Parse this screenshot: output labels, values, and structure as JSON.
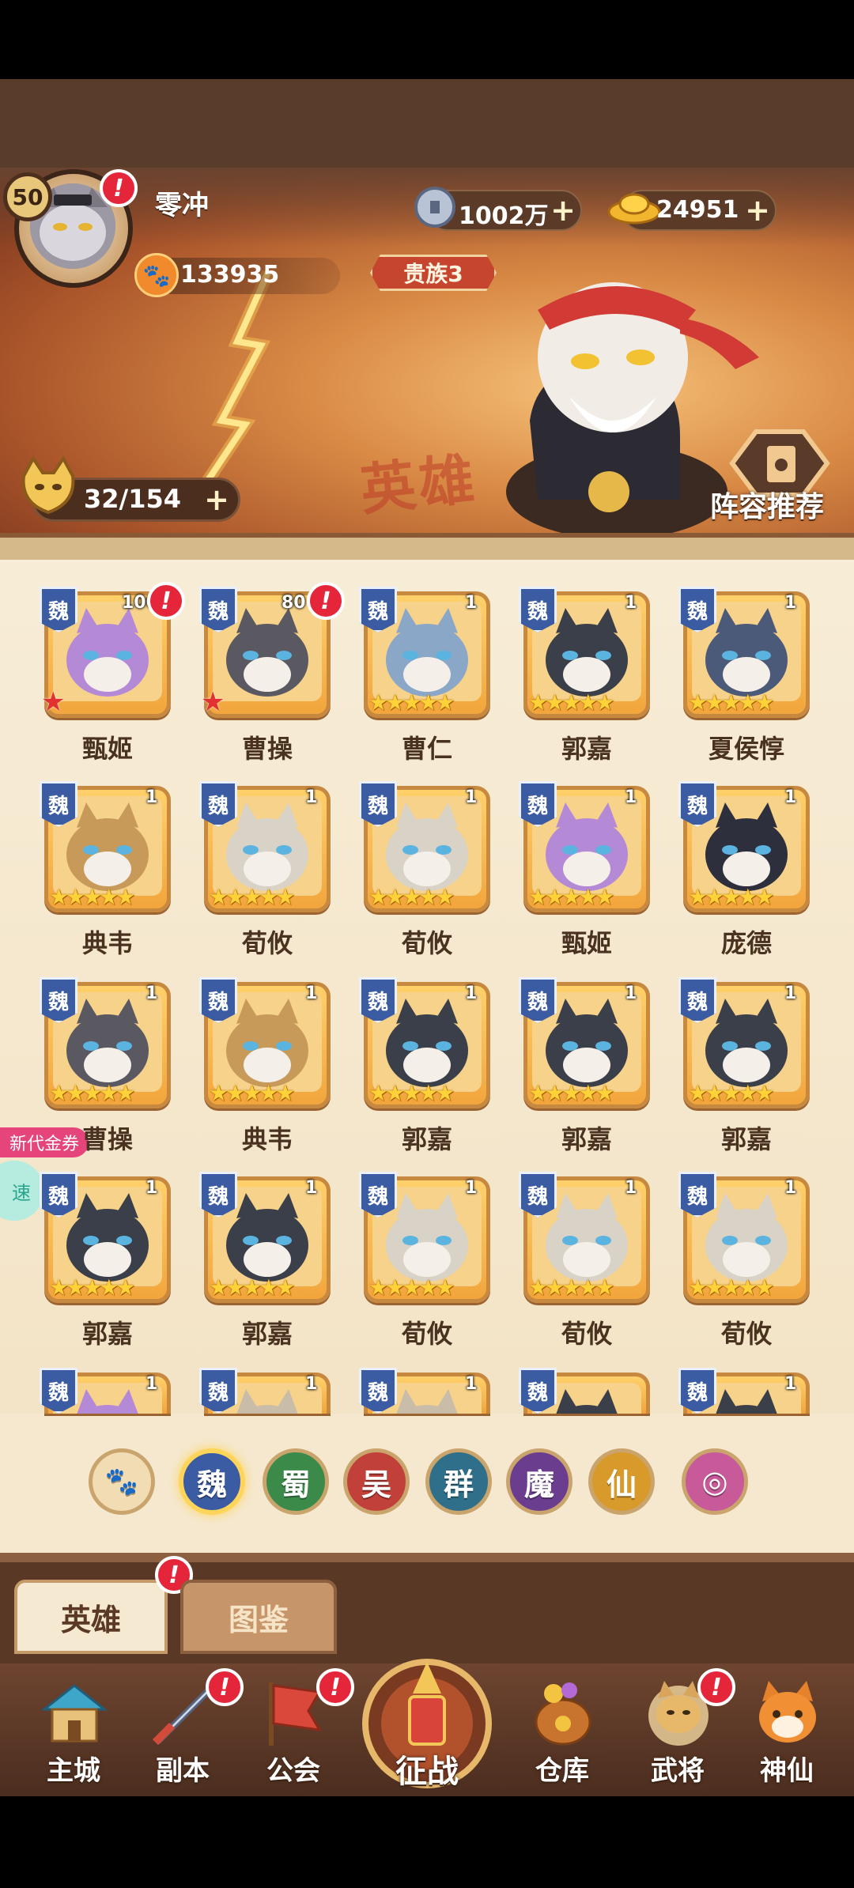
{
  "player": {
    "level": "50",
    "name": "零冲",
    "power": "133935",
    "rank": "贵族3"
  },
  "resources": {
    "coins": "1002万",
    "gold": "24951"
  },
  "hero_count": "32/154",
  "lineup_label": "阵容推荐",
  "banner_watermark": "英雄",
  "heroes": [
    {
      "name": "甄姬",
      "faction": "魏",
      "level": "100",
      "stars": "",
      "red_star": true,
      "alert": true,
      "color": "#b48ad6"
    },
    {
      "name": "曹操",
      "faction": "魏",
      "level": "80",
      "stars": "",
      "red_star": true,
      "alert": true,
      "color": "#5a5860"
    },
    {
      "name": "曹仁",
      "faction": "魏",
      "level": "1",
      "stars": "★★★★★",
      "red_star": false,
      "alert": false,
      "color": "#8aa7c7"
    },
    {
      "name": "郭嘉",
      "faction": "魏",
      "level": "1",
      "stars": "★★★★★",
      "red_star": false,
      "alert": false,
      "color": "#3a3f4a"
    },
    {
      "name": "夏侯惇",
      "faction": "魏",
      "level": "1",
      "stars": "★★★★★",
      "red_star": false,
      "alert": false,
      "color": "#4b5a78"
    },
    {
      "name": "典韦",
      "faction": "魏",
      "level": "1",
      "stars": "★★★★★",
      "red_star": false,
      "alert": false,
      "color": "#c89a5a"
    },
    {
      "name": "荀攸",
      "faction": "魏",
      "level": "1",
      "stars": "★★★★★",
      "red_star": false,
      "alert": false,
      "color": "#d9d2c6"
    },
    {
      "name": "荀攸",
      "faction": "魏",
      "level": "1",
      "stars": "★★★★★",
      "red_star": false,
      "alert": false,
      "color": "#d9d2c6"
    },
    {
      "name": "甄姬",
      "faction": "魏",
      "level": "1",
      "stars": "★★★★★",
      "red_star": false,
      "alert": false,
      "color": "#b48ad6"
    },
    {
      "name": "庞德",
      "faction": "魏",
      "level": "1",
      "stars": "★★★★★",
      "red_star": false,
      "alert": false,
      "color": "#2e2f3d"
    },
    {
      "name": "曹操",
      "faction": "魏",
      "level": "1",
      "stars": "★★★★★",
      "red_star": false,
      "alert": false,
      "color": "#5a5860"
    },
    {
      "name": "典韦",
      "faction": "魏",
      "level": "1",
      "stars": "★★★★★",
      "red_star": false,
      "alert": false,
      "color": "#c89a5a"
    },
    {
      "name": "郭嘉",
      "faction": "魏",
      "level": "1",
      "stars": "★★★★★",
      "red_star": false,
      "alert": false,
      "color": "#3a3f4a"
    },
    {
      "name": "郭嘉",
      "faction": "魏",
      "level": "1",
      "stars": "★★★★★",
      "red_star": false,
      "alert": false,
      "color": "#3a3f4a"
    },
    {
      "name": "郭嘉",
      "faction": "魏",
      "level": "1",
      "stars": "★★★★★",
      "red_star": false,
      "alert": false,
      "color": "#3a3f4a"
    },
    {
      "name": "郭嘉",
      "faction": "魏",
      "level": "1",
      "stars": "★★★★★",
      "red_star": false,
      "alert": false,
      "color": "#3a3f4a"
    },
    {
      "name": "郭嘉",
      "faction": "魏",
      "level": "1",
      "stars": "★★★★★",
      "red_star": false,
      "alert": false,
      "color": "#3a3f4a"
    },
    {
      "name": "荀攸",
      "faction": "魏",
      "level": "1",
      "stars": "★★★★★",
      "red_star": false,
      "alert": false,
      "color": "#d9d2c6"
    },
    {
      "name": "荀攸",
      "faction": "魏",
      "level": "1",
      "stars": "★★★★★",
      "red_star": false,
      "alert": false,
      "color": "#d9d2c6"
    },
    {
      "name": "荀攸",
      "faction": "魏",
      "level": "1",
      "stars": "★★★★★",
      "red_star": false,
      "alert": false,
      "color": "#d9d2c6"
    },
    {
      "name": "",
      "faction": "魏",
      "level": "1",
      "stars": "",
      "red_star": false,
      "alert": false,
      "color": "#b48ad6"
    },
    {
      "name": "",
      "faction": "魏",
      "level": "1",
      "stars": "",
      "red_star": false,
      "alert": false,
      "color": "#c9bca8"
    },
    {
      "name": "",
      "faction": "魏",
      "level": "1",
      "stars": "",
      "red_star": false,
      "alert": false,
      "color": "#c9bca8"
    },
    {
      "name": "",
      "faction": "魏",
      "level": "",
      "stars": "",
      "red_star": false,
      "alert": false,
      "color": "#3a3f4a"
    },
    {
      "name": "",
      "faction": "魏",
      "level": "1",
      "stars": "",
      "red_star": false,
      "alert": false,
      "color": "#3a3f4a"
    }
  ],
  "side": {
    "promo": "新代金券",
    "speed": "速"
  },
  "factions": [
    {
      "key": "all",
      "label": "🐾",
      "color": "#f1dcb3",
      "active": false
    },
    {
      "key": "wei",
      "label": "魏",
      "color": "#3b5ba2",
      "active": true
    },
    {
      "key": "shu",
      "label": "蜀",
      "color": "#3b8a4a",
      "active": false
    },
    {
      "key": "wu",
      "label": "吴",
      "color": "#c2403a",
      "active": false
    },
    {
      "key": "qun",
      "label": "群",
      "color": "#2f6f8a",
      "active": false
    },
    {
      "key": "mo",
      "label": "魔",
      "color": "#6b3d8f",
      "active": false
    },
    {
      "key": "xian",
      "label": "仙",
      "color": "#d89a2a",
      "active": false
    },
    {
      "key": "special",
      "label": "◎",
      "color": "#c85a9a",
      "active": false
    }
  ],
  "tabs": {
    "heroes": "英雄",
    "codex": "图鉴"
  },
  "nav": {
    "main_city": "主城",
    "dungeon": "副本",
    "guild": "公会",
    "battle": "征战",
    "warehouse": "仓库",
    "generals": "武将",
    "deity": "神仙"
  },
  "alert_mark": "!",
  "plus_mark": "+"
}
